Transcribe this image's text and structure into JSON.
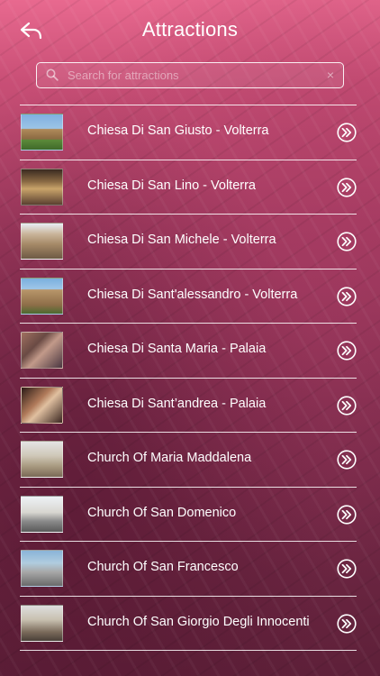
{
  "header": {
    "title": "Attractions",
    "back_icon": "back-arrow-icon"
  },
  "search": {
    "placeholder": "Search for attractions",
    "value": "",
    "clear_label": "×"
  },
  "colors": {
    "background_top": "#e8698f",
    "background_bottom": "#5e2039",
    "divider": "#ffffff"
  },
  "attractions": [
    {
      "name": "Chiesa Di San Giusto - Volterra",
      "thumb_icon": "church-photo"
    },
    {
      "name": "Chiesa Di San Lino - Volterra",
      "thumb_icon": "church-interior-photo"
    },
    {
      "name": "Chiesa Di San Michele - Volterra",
      "thumb_icon": "church-photo"
    },
    {
      "name": "Chiesa Di Sant'alessandro - Volterra",
      "thumb_icon": "church-photo"
    },
    {
      "name": "Chiesa Di Santa Maria - Palaia",
      "thumb_icon": "fresco-photo"
    },
    {
      "name": "Chiesa Di Sant’andrea - Palaia",
      "thumb_icon": "painting-photo"
    },
    {
      "name": "Church Of Maria Maddalena",
      "thumb_icon": "facade-photo"
    },
    {
      "name": "Church Of San Domenico",
      "thumb_icon": "facade-photo"
    },
    {
      "name": "Church Of San Francesco",
      "thumb_icon": "facade-photo"
    },
    {
      "name": "Church Of San Giorgio Degli Innocenti",
      "thumb_icon": "facade-photo"
    }
  ]
}
